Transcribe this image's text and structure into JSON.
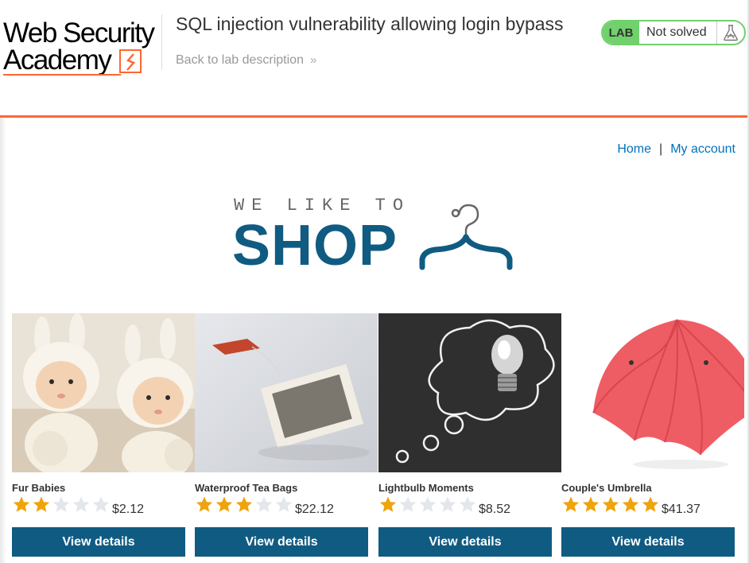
{
  "header": {
    "logo_line1": "Web Security",
    "logo_line2": "Academy",
    "lab_title": "SQL injection vulnerability allowing login bypass",
    "back_link": "Back to lab description",
    "lab_badge": "LAB",
    "lab_status": "Not solved",
    "accent_color": "#ff6633",
    "status_color": "#70d16d"
  },
  "nav": {
    "home": "Home",
    "separator": "|",
    "my_account": "My account"
  },
  "hero": {
    "tagline": "WE LIKE TO",
    "title": "SHOP",
    "brand_color": "#105b82"
  },
  "products": [
    {
      "name": "Fur Babies",
      "rating": 2,
      "price": "$2.12",
      "button": "View details",
      "image": "twin-babies-in-bunny-hats"
    },
    {
      "name": "Waterproof Tea Bags",
      "rating": 3,
      "price": "$22.12",
      "button": "View details",
      "image": "tea-bag"
    },
    {
      "name": "Lightbulb Moments",
      "rating": 1,
      "price": "$8.52",
      "button": "View details",
      "image": "lightbulb-chalk-thought-bubble"
    },
    {
      "name": "Couple's Umbrella",
      "rating": 5,
      "price": "$41.37",
      "button": "View details",
      "image": "red-double-umbrella"
    }
  ]
}
